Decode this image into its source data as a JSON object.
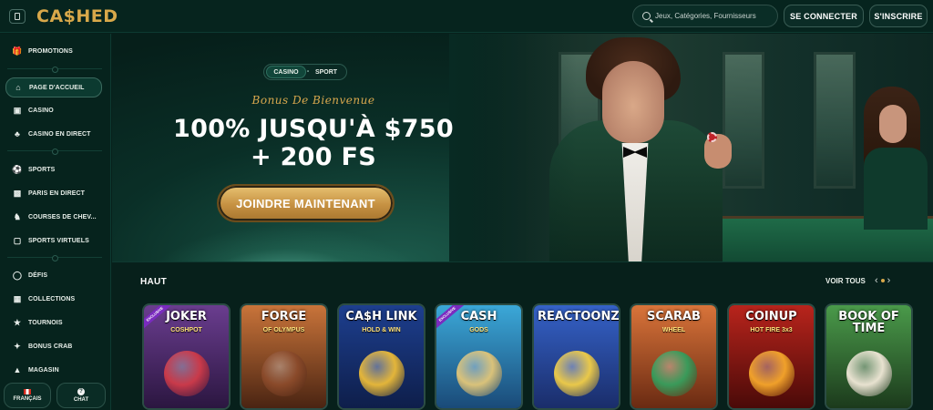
{
  "header": {
    "logo": "CA$HED",
    "search_placeholder": "Jeux, Catégories, Fournisseurs",
    "login_label": "SE CONNECTER",
    "signup_label": "S'INSCRIRE"
  },
  "sidebar": {
    "items": [
      {
        "label": "PROMOTIONS",
        "icon": "gift-icon"
      },
      {
        "label": "PAGE D'ACCUEIL",
        "icon": "home-icon"
      },
      {
        "label": "CASINO",
        "icon": "slot-machine-icon"
      },
      {
        "label": "CASINO EN DIRECT",
        "icon": "live-cards-icon"
      },
      {
        "label": "SPORTS",
        "icon": "ball-icon"
      },
      {
        "label": "PARIS EN DIRECT",
        "icon": "live-badge-icon"
      },
      {
        "label": "COURSES DE CHEV...",
        "icon": "horse-icon"
      },
      {
        "label": "SPORTS VIRTUELS",
        "icon": "virtual-sports-icon"
      },
      {
        "label": "DÉFIS",
        "icon": "medal-icon"
      },
      {
        "label": "COLLECTIONS",
        "icon": "collections-icon"
      },
      {
        "label": "TOURNOIS",
        "icon": "trophy-icon"
      },
      {
        "label": "BONUS CRAB",
        "icon": "claw-icon"
      },
      {
        "label": "MAGASIN",
        "icon": "shop-icon"
      }
    ],
    "language_label": "FRANÇAIS",
    "chat_label": "CHAT"
  },
  "hero": {
    "tab_casino": "CASINO",
    "tab_separator": "•",
    "tab_sport": "SPORT",
    "bonus_label": "Bonus De Bienvenue",
    "headline_line1": "100% JUSQU'À $750",
    "headline_line2": "+ 200 FS",
    "cta_label": "JOINDRE MAINTENANT"
  },
  "games": {
    "section_title": "HAUT",
    "view_all_label": "VOIR TOUS",
    "cards": [
      {
        "title": "JOKER",
        "subtitle": "COSHPOT",
        "badge": "EXCLUSIVE",
        "bg1": "#6a3d8f",
        "bg2": "#2b1640",
        "emblem": "#c93a4a"
      },
      {
        "title": "FORGE",
        "subtitle": "OF OLYMPUS",
        "badge": "",
        "bg1": "#c9743a",
        "bg2": "#4a2412",
        "emblem": "#8a4a2a"
      },
      {
        "title": "CA$H LINK",
        "subtitle": "HOLD & WIN",
        "badge": "",
        "bg1": "#1d3f8f",
        "bg2": "#0e1e4a",
        "emblem": "#e3b53a"
      },
      {
        "title": "CASH",
        "subtitle": "GODS",
        "badge": "EXCLUSIVE",
        "bg1": "#3ba8d8",
        "bg2": "#1a4a78",
        "emblem": "#d9c27a"
      },
      {
        "title": "REACTOONZ",
        "subtitle": "",
        "badge": "",
        "bg1": "#3562c8",
        "bg2": "#1a2d6a",
        "emblem": "#e9c84a"
      },
      {
        "title": "SCARAB",
        "subtitle": "WHEEL",
        "badge": "",
        "bg1": "#d9743a",
        "bg2": "#6a2a12",
        "emblem": "#3a9a5a"
      },
      {
        "title": "COINUP",
        "subtitle": "HOT FIRE 3x3",
        "badge": "",
        "bg1": "#b8241c",
        "bg2": "#4a0a08",
        "emblem": "#f0a02a"
      },
      {
        "title": "BOOK OF TIME",
        "subtitle": "",
        "badge": "",
        "bg1": "#4a9a4a",
        "bg2": "#1c3a1c",
        "emblem": "#e8e2d0"
      }
    ]
  }
}
